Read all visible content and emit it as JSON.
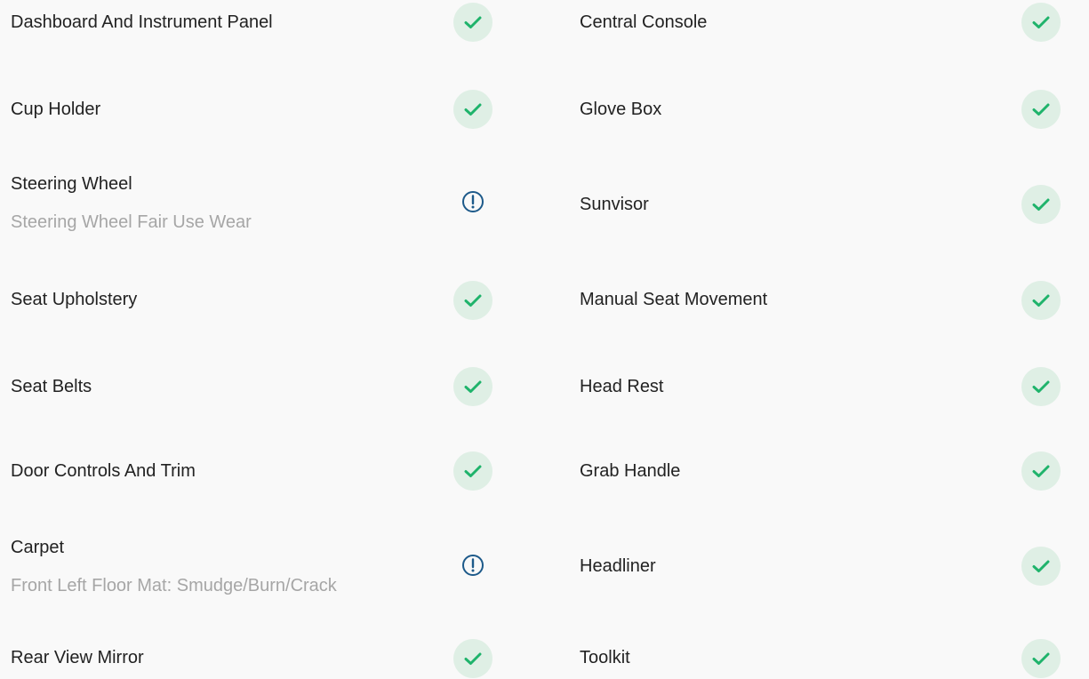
{
  "colors": {
    "ok_fill": "#dfefe5",
    "ok_check": "#1fb36b",
    "warn": "#1d5a8a",
    "subtext": "#a6a6a6"
  },
  "rows": [
    {
      "left": {
        "label": "Dashboard And Instrument Panel",
        "sub": "",
        "status": "ok",
        "icon": "check-icon"
      },
      "right": {
        "label": "Central Console",
        "sub": "",
        "status": "ok",
        "icon": "check-icon"
      }
    },
    {
      "left": {
        "label": "Cup Holder",
        "sub": "",
        "status": "ok",
        "icon": "check-icon"
      },
      "right": {
        "label": "Glove Box",
        "sub": "",
        "status": "ok",
        "icon": "check-icon"
      }
    },
    {
      "left": {
        "label": "Steering Wheel",
        "sub": "Steering Wheel Fair Use Wear",
        "status": "warning",
        "icon": "alert-icon"
      },
      "right": {
        "label": "Sunvisor",
        "sub": "",
        "status": "ok",
        "icon": "check-icon"
      }
    },
    {
      "left": {
        "label": "Seat Upholstery",
        "sub": "",
        "status": "ok",
        "icon": "check-icon"
      },
      "right": {
        "label": "Manual Seat Movement",
        "sub": "",
        "status": "ok",
        "icon": "check-icon"
      }
    },
    {
      "left": {
        "label": "Seat Belts",
        "sub": "",
        "status": "ok",
        "icon": "check-icon"
      },
      "right": {
        "label": "Head Rest",
        "sub": "",
        "status": "ok",
        "icon": "check-icon"
      }
    },
    {
      "left": {
        "label": "Door Controls And Trim",
        "sub": "",
        "status": "ok",
        "icon": "check-icon"
      },
      "right": {
        "label": "Grab Handle",
        "sub": "",
        "status": "ok",
        "icon": "check-icon"
      }
    },
    {
      "left": {
        "label": "Carpet",
        "sub": "Front Left Floor Mat: Smudge/Burn/Crack",
        "status": "warning",
        "icon": "alert-icon"
      },
      "right": {
        "label": "Headliner",
        "sub": "",
        "status": "ok",
        "icon": "check-icon"
      }
    },
    {
      "left": {
        "label": "Rear View Mirror",
        "sub": "",
        "status": "ok",
        "icon": "check-icon"
      },
      "right": {
        "label": "Toolkit",
        "sub": "",
        "status": "ok",
        "icon": "check-icon"
      }
    }
  ]
}
